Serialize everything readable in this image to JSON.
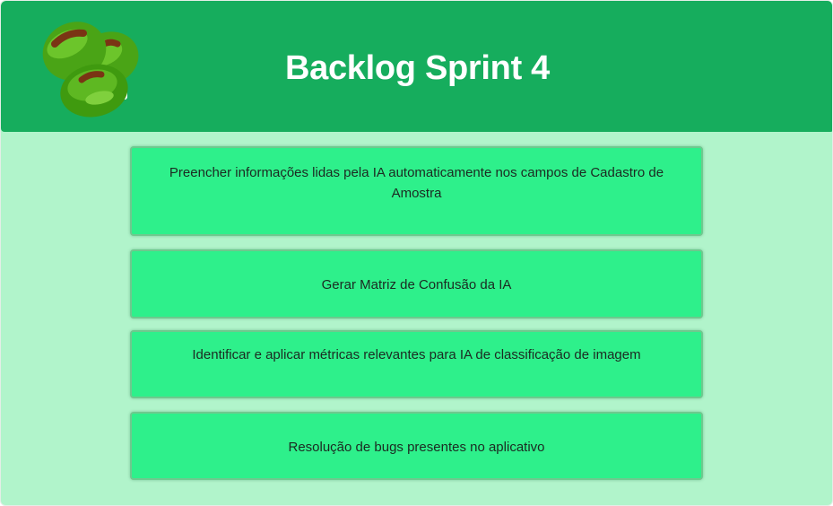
{
  "header": {
    "title": "Backlog Sprint 4",
    "logo_icon": "green-olives-icon"
  },
  "backlog": {
    "items": [
      {
        "label": "Preencher informações lidas pela IA automaticamente nos campos de Cadastro de Amostra"
      },
      {
        "label": "Gerar Matriz de Confusão da IA"
      },
      {
        "label": "Identificar e aplicar métricas relevantes para IA de classificação de imagem"
      },
      {
        "label": "Resolução de bugs presentes no aplicativo"
      }
    ]
  },
  "colors": {
    "header_bg": "#16ad5d",
    "page_bg": "#b1f4cb",
    "card_bg": "#2ef08b",
    "card_border": "#6ec98e",
    "title_text": "#ffffff"
  }
}
